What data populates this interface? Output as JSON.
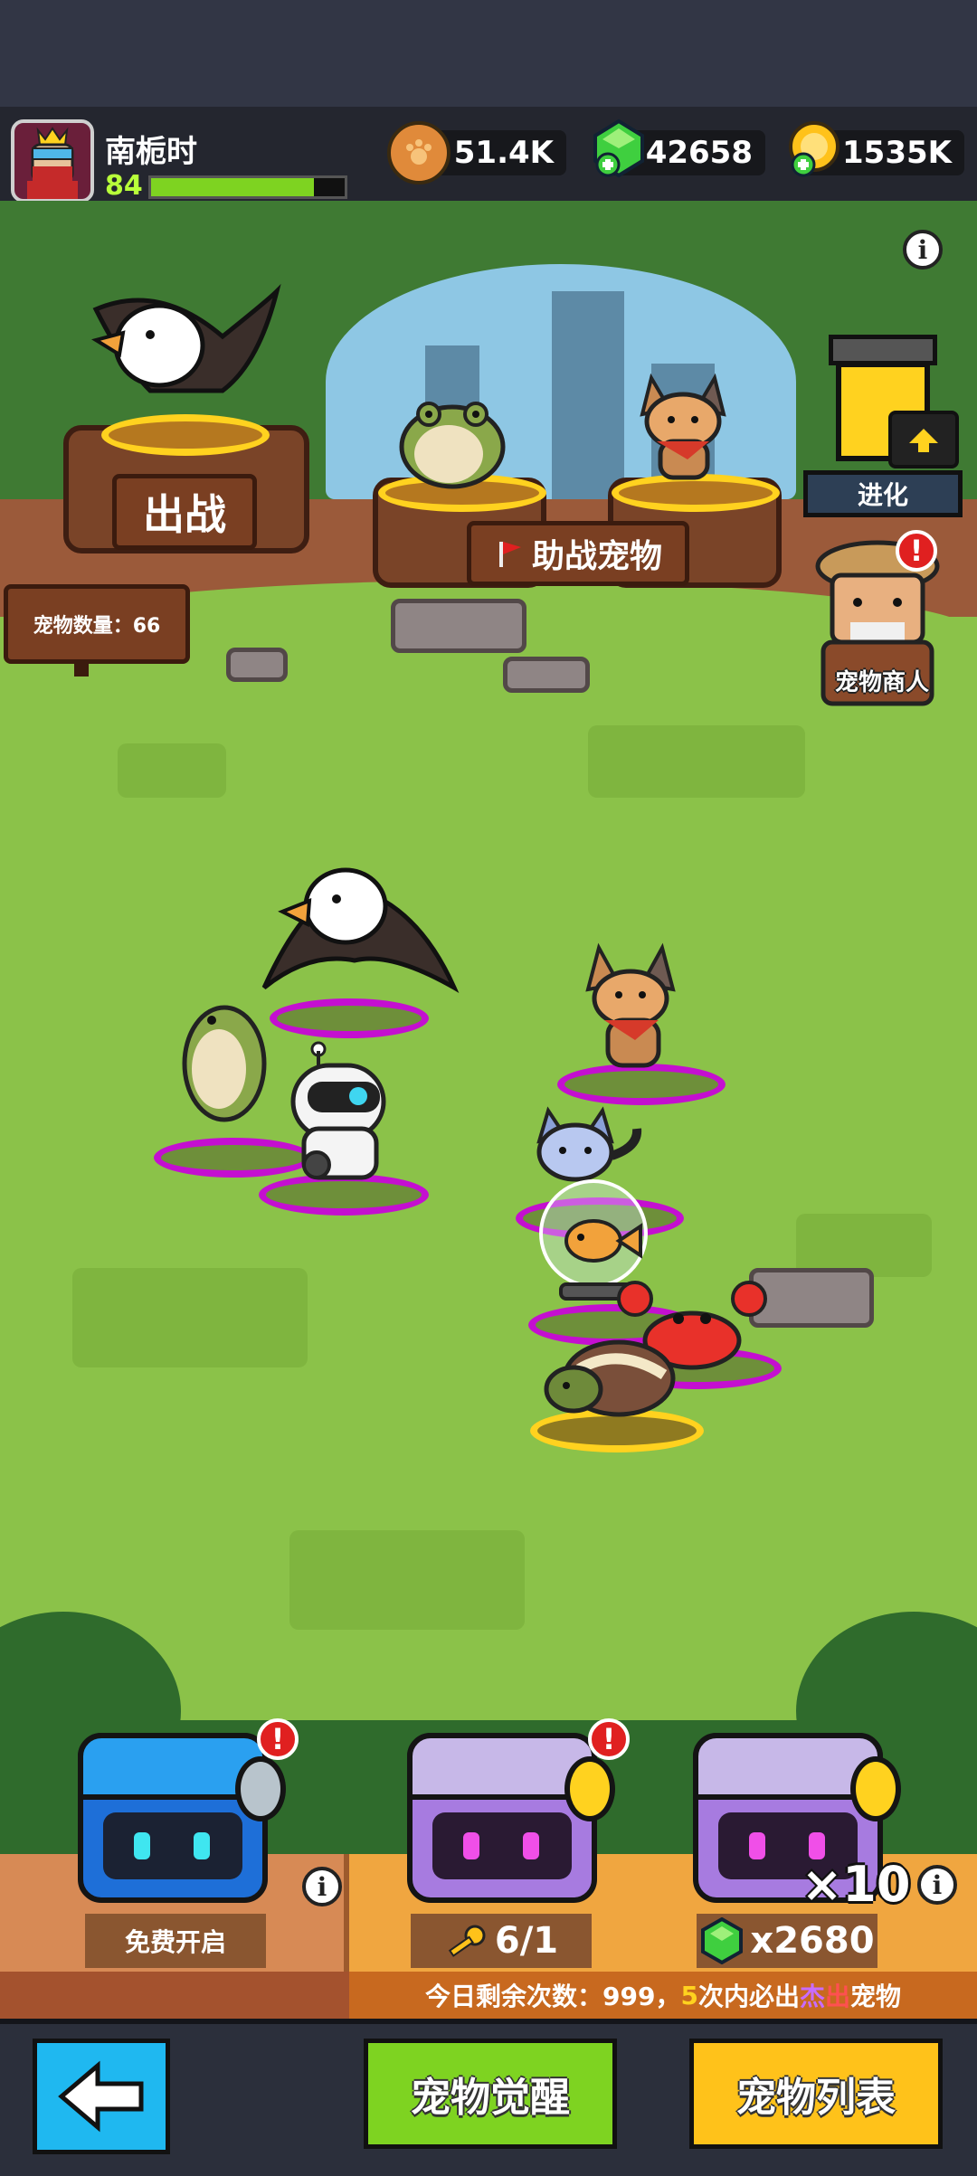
{
  "player": {
    "name": "南栀时",
    "level": "84",
    "xp_fraction": 0.84
  },
  "resources": {
    "paw_coins": "51.4K",
    "gems": "42658",
    "gold": "1535K"
  },
  "scene": {
    "battle_label": "出战",
    "assist_label": "助战宠物",
    "pet_count_label": "宠物数量：66",
    "evolve_label": "进化",
    "merchant_label": "宠物商人"
  },
  "chests": {
    "free": {
      "label": "免费开启"
    },
    "key": {
      "label": "6/1"
    },
    "gem": {
      "multiplier": "×10",
      "price": "x2680"
    }
  },
  "notice": {
    "prefix": "今日剩余次数：999，",
    "count": "5",
    "mid": "次内必出",
    "highlight_a": "杰",
    "highlight_b": "出",
    "suffix": "宠物"
  },
  "buttons": {
    "awaken": "宠物觉醒",
    "pet_list": "宠物列表"
  },
  "colors": {
    "gold_ring": "#ffd21f",
    "purple_ring": "#c40fd0",
    "awaken_button": "#7ed321",
    "list_button": "#ffc21a",
    "back_button": "#1fb8f0",
    "alert": "#e02020"
  },
  "icons": {
    "back": "arrow-left-icon",
    "info": "info-icon",
    "alert": "exclamation-icon",
    "flag": "red-flag-icon",
    "key": "key-icon",
    "paw": "paw-coin-icon",
    "gem": "gem-icon",
    "gold": "gold-coin-icon",
    "evolve": "arrow-up-icon"
  }
}
